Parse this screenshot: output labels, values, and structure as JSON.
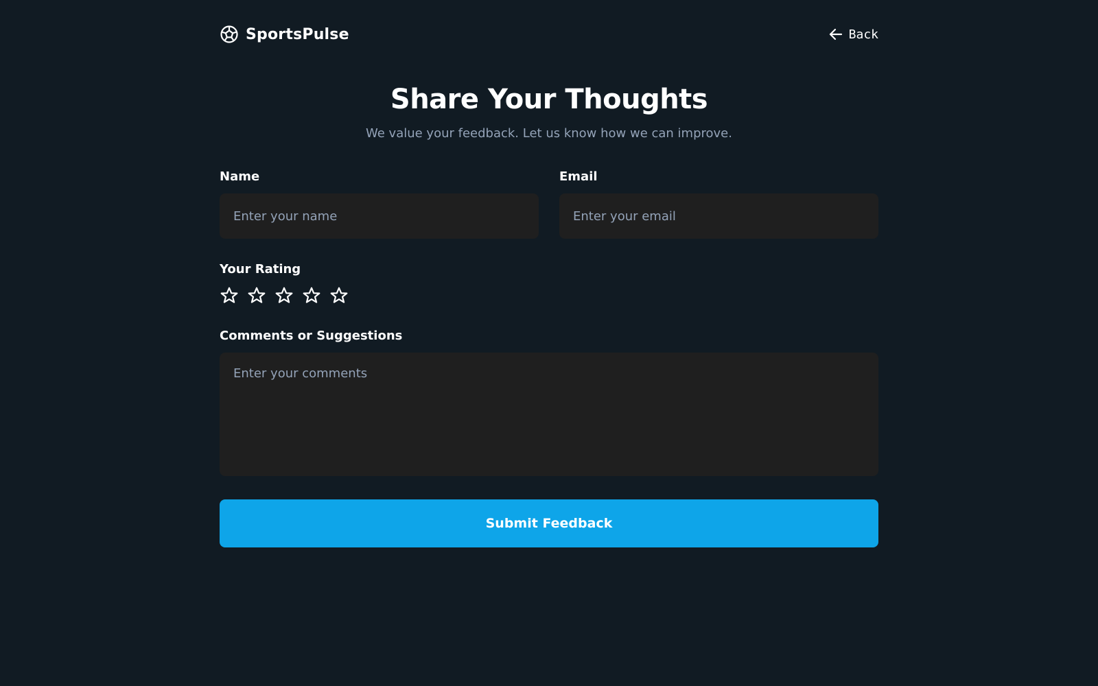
{
  "brand": {
    "name": "SportsPulse",
    "icon": "soccer-ball-icon"
  },
  "nav": {
    "back_label": "Back",
    "back_icon": "arrow-left-icon"
  },
  "hero": {
    "title": "Share Your Thoughts",
    "subtitle": "We value your feedback. Let us know how we can improve."
  },
  "form": {
    "name": {
      "label": "Name",
      "placeholder": "Enter your name",
      "value": ""
    },
    "email": {
      "label": "Email",
      "placeholder": "Enter your email",
      "value": ""
    },
    "rating": {
      "label": "Your Rating",
      "max": 5,
      "value": 0,
      "icon": "star-outline-icon"
    },
    "comments": {
      "label": "Comments or Suggestions",
      "placeholder": "Enter your comments",
      "value": ""
    },
    "submit_label": "Submit Feedback"
  },
  "colors": {
    "background": "#111b23",
    "input_background": "#1f1f1f",
    "accent": "#0ea5e9",
    "muted_text": "#94a3b8",
    "text": "#ffffff"
  }
}
